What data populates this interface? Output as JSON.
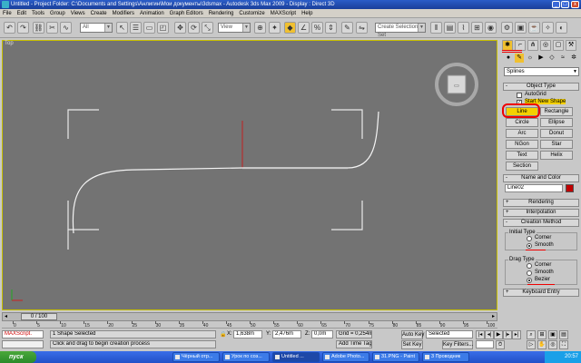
{
  "titlebar": {
    "text": "Untitled      - Project Folder: C:\\Documents and Settings\\Анлигин\\Мои документы\\3dsmax      - Autodesk 3ds Max  2009          - Display : Direct 3D",
    "min": "_",
    "max": "□",
    "close": "x"
  },
  "menu": [
    "File",
    "Edit",
    "Tools",
    "Group",
    "Views",
    "Create",
    "Modifiers",
    "Animation",
    "Graph Editors",
    "Rendering",
    "Customize",
    "MAXScript",
    "Help"
  ],
  "toolbar": {
    "filter_value": "All",
    "view_value": "View",
    "named_selection_placeholder": "Create Selection Set"
  },
  "viewport": {
    "label": "Top"
  },
  "panel": {
    "category_dropdown": "Splines",
    "object_type_title": "Object Type",
    "autogrid_label": "AutoGrid",
    "start_new_shape_label": "Start New Shape",
    "buttons": [
      "Line",
      "Rectangle",
      "Circle",
      "Ellipse",
      "Arc",
      "Donut",
      "NGon",
      "Star",
      "Text",
      "Helix",
      "Section"
    ],
    "name_color_title": "Name and Color",
    "object_name": "Line02",
    "object_color": "#c00000",
    "rendering_title": "Rendering",
    "interpolation_title": "Interpolation",
    "creation_method_title": "Creation Method",
    "initial_type_label": "Initial Type",
    "initial_options": [
      "Corner",
      "Smooth"
    ],
    "drag_type_label": "Drag Type",
    "drag_options": [
      "Corner",
      "Smooth",
      "Bezier"
    ],
    "keyboard_entry_title": "Keyboard Entry"
  },
  "timeline": {
    "slider_label": "0 / 100",
    "ticks": [
      "0",
      "5",
      "10",
      "15",
      "20",
      "25",
      "30",
      "35",
      "40",
      "45",
      "50",
      "55",
      "60",
      "65",
      "70",
      "75",
      "80",
      "85",
      "90",
      "95",
      "100"
    ]
  },
  "status": {
    "maxscript": "MAXScript.",
    "selected_text": "1 Shape Selected",
    "prompt_text": "Click and drag to begin creation process",
    "x_label": "X:",
    "x_value": "1,638m",
    "y_label": "Y:",
    "y_value": "2,476m",
    "z_label": "Z:",
    "z_value": "0,0m",
    "grid_text": "Grid = 0,254m",
    "add_time_tag": "Add Time Tag",
    "auto_key": "Auto Key",
    "set_key": "Set Key",
    "key_mode_value": "Selected",
    "key_filters": "Key Filters..."
  },
  "taskbar": {
    "start": "пуск",
    "tasks": [
      "Чёрный отр...",
      "Урок по соз...",
      "Untitled ...",
      "Adobe Photo...",
      "31.PNG - Paint",
      "3 Проводник"
    ],
    "clock": "20:57"
  }
}
